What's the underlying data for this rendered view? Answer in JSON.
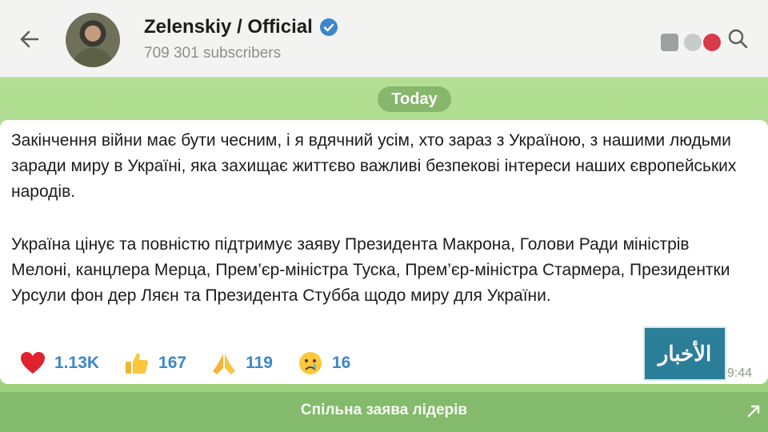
{
  "header": {
    "title": "Zelenskiy / Official",
    "subscribers": "709 301 subscribers"
  },
  "chat": {
    "date": "Today",
    "message": {
      "paragraph1": "Закінчення війни має бути чесним, і я вдячний усім, хто зараз з Україною, з нашими людьми заради миру в Україні, яка захищає життєво важливі безпекові інтереси наших європейських народів.",
      "paragraph2": "Україна цінує та повністю підтримує заяву Президента Макрона, Голови Ради міністрів Мелоні, канцлера Мерца, Прем’єр-міністра Туска, Прем’єр-міністра Стармера, Президентки Урсули фон дер Ляєн та Президента Стубба щодо миру для України.",
      "time": "09:44",
      "reactions": [
        {
          "emoji": "heart",
          "count": "1.13K"
        },
        {
          "emoji": "thumbs-up",
          "count": "167"
        },
        {
          "emoji": "folded-hands",
          "count": "119"
        },
        {
          "emoji": "crying-face",
          "count": "16"
        }
      ]
    }
  },
  "overlay": {
    "news_badge": "الأخبار"
  },
  "footer": {
    "label": "Спільна заява лідерів"
  },
  "colors": {
    "accent": "#3b87c8",
    "chat_background": "#a9d98a",
    "badge": "#2b7e97"
  }
}
